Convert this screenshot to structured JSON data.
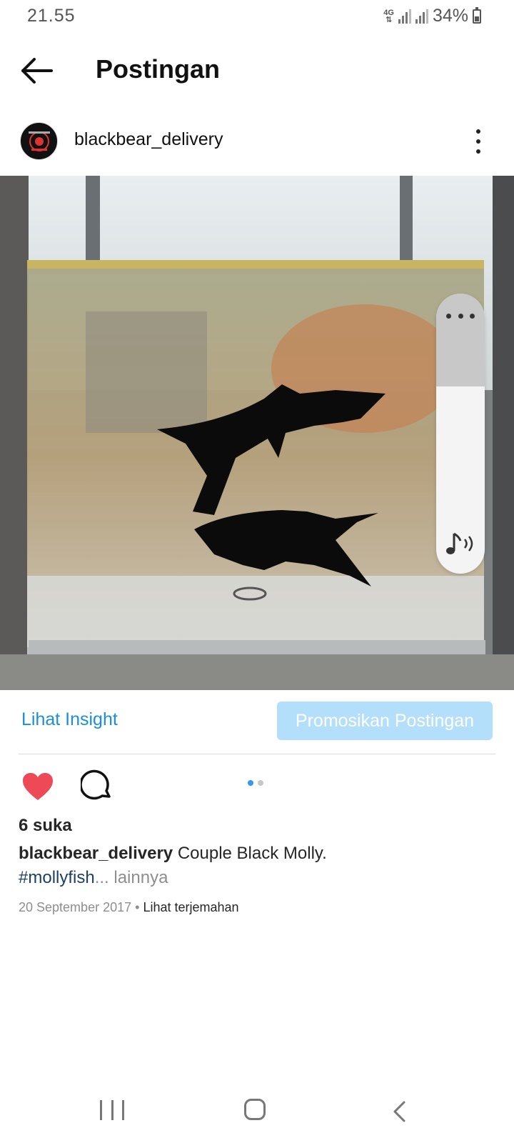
{
  "status_bar": {
    "time": "21.55",
    "network": "4G",
    "battery": "34%"
  },
  "header": {
    "title": "Postingan",
    "back_icon": "arrow-left-icon"
  },
  "post": {
    "username": "blackbear_delivery",
    "avatar_icon": "brand-logo-avatar",
    "more_icon": "vertical-dots-icon",
    "image_alt": "Two black molly fish in a small glass aquarium",
    "carousel": {
      "current": 1,
      "total": 2
    }
  },
  "volume_panel": {
    "more_icon": "horizontal-dots-icon",
    "media_icon": "music-volume-icon",
    "level": 0.67
  },
  "actions": {
    "insight_label": "Lihat Insight",
    "promote_label": "Promosikan Postingan",
    "like_icon": "heart-filled-icon",
    "comment_icon": "comment-icon"
  },
  "details": {
    "likes": "6 suka",
    "caption_user": "blackbear_delivery",
    "caption_text": "Couple Black Molly.",
    "hashtag": "#mollyfish",
    "more_label": "... lainnya",
    "date": "20 September 2017",
    "separator": " • ",
    "translate_label": "Lihat terjemahan"
  },
  "colors": {
    "accent": "#1a8fd6",
    "promote_bg": "#b3dffb",
    "like_red": "#ed4956",
    "dot_active": "#3897f0",
    "dot_inactive": "#c7c7c7"
  },
  "nav_bar": {
    "recent_icon": "recent-apps-icon",
    "home_icon": "home-icon",
    "back_icon": "nav-back-icon"
  }
}
